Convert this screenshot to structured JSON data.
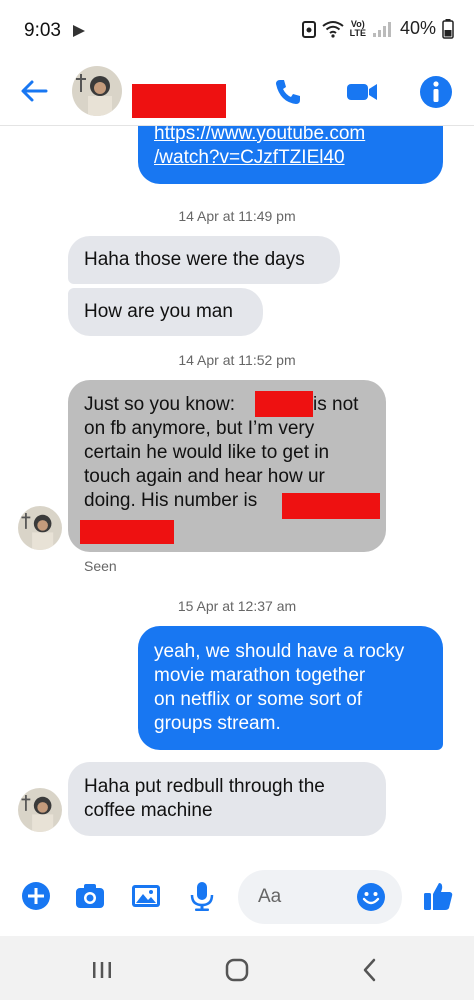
{
  "status_bar": {
    "time": "9:03",
    "volte_label_1": "Vo)",
    "volte_label_2": "LTE",
    "battery": "40%"
  },
  "header": {
    "contact_name_redacted": true
  },
  "messages": [
    {
      "id": "m1",
      "direction": "outgoing",
      "text_line_1": "https://www.youtube.com",
      "text_line_2": "/watch?v=CJzfTZIEl40",
      "is_link": true
    },
    {
      "id": "t1",
      "type": "timestamp",
      "text": "14 Apr at 11:49 pm"
    },
    {
      "id": "m2",
      "direction": "incoming",
      "text": "Haha those were the days"
    },
    {
      "id": "m3",
      "direction": "incoming",
      "text": "How are you man"
    },
    {
      "id": "t2",
      "type": "timestamp",
      "text": "14 Apr at 11:52 pm"
    },
    {
      "id": "m4",
      "direction": "incoming",
      "highlighted": true,
      "line_1a": "Just so you know:",
      "line_1b": "is not",
      "line_2": "on fb anymore, but I’m very",
      "line_3": "certain he would like to get in",
      "line_4": "touch again and hear how ur",
      "line_5": "doing. His number is"
    },
    {
      "id": "s1",
      "type": "seen",
      "text": "Seen"
    },
    {
      "id": "t3",
      "type": "timestamp",
      "text": "15 Apr at 12:37 am"
    },
    {
      "id": "m5",
      "direction": "outgoing",
      "line_1": "yeah, we should have a rocky",
      "line_2": "movie marathon together",
      "line_3": "on netflix or some sort of",
      "line_4": "groups stream."
    },
    {
      "id": "m6",
      "direction": "incoming",
      "line_1": "Haha put redbull through the",
      "line_2": "coffee machine"
    }
  ],
  "composer": {
    "placeholder": "Aa"
  },
  "colors": {
    "accent": "#1877f2",
    "incoming_bubble": "#e4e6eb",
    "highlight_bubble": "#bdbdbd",
    "redaction": "#ee1111"
  }
}
